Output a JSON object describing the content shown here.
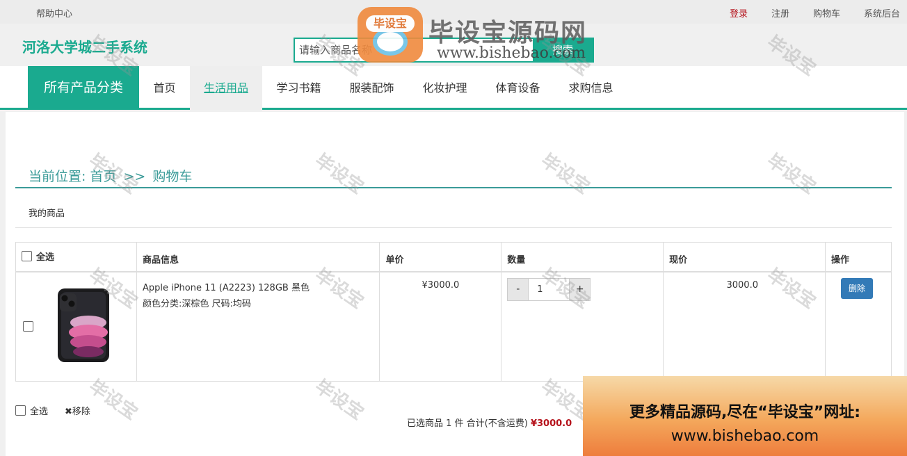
{
  "topbar": {
    "help": "帮助中心",
    "login": "登录",
    "register": "注册",
    "cart": "购物车",
    "admin": "系统后台"
  },
  "header": {
    "site_title": "河洛大学城二手系统",
    "search_placeholder": "请输入商品名称",
    "search_button": "搜索"
  },
  "nav": {
    "all_categories": "所有产品分类",
    "items": [
      {
        "label": "首页",
        "active": false
      },
      {
        "label": "生活用品",
        "active": true
      },
      {
        "label": "学习书籍",
        "active": false
      },
      {
        "label": "服装配饰",
        "active": false
      },
      {
        "label": "化妆护理",
        "active": false
      },
      {
        "label": "体育设备",
        "active": false
      },
      {
        "label": "求购信息",
        "active": false
      }
    ]
  },
  "breadcrumb": {
    "prefix": "当前位置:",
    "home": "首页",
    "arrow": ">>",
    "current": "购物车"
  },
  "section_title": "我的商品",
  "cart_table": {
    "headers": {
      "select_all": "全选",
      "info": "商品信息",
      "unit_price": "单价",
      "quantity": "数量",
      "now_price": "现价",
      "action": "操作"
    },
    "rows": [
      {
        "name": "Apple iPhone 11 (A2223) 128GB 黑色",
        "spec": "颜色分类:深棕色 尺码:均码",
        "unit_price": "¥3000.0",
        "qty_dec": "-",
        "quantity": "1",
        "qty_inc": "+",
        "now_price": "3000.0",
        "delete_label": "删除"
      }
    ]
  },
  "footer": {
    "select_all": "全选",
    "remove": "✖移除",
    "summary": "已选商品 1 件 合计(不含运费)",
    "total": "¥3000.0"
  },
  "watermark": {
    "text": "毕设宝",
    "logo_badge": "毕设宝",
    "logo_name": "毕设宝源码网",
    "logo_url": "www.bishebao.com"
  },
  "promo": {
    "line1": "更多精品源码,尽在“毕设宝”网址:",
    "line2": "www.bishebao.com"
  },
  "colors": {
    "brand": "#1aaa8f",
    "accent_red": "#b5121b",
    "delete_button": "#337ab7"
  }
}
